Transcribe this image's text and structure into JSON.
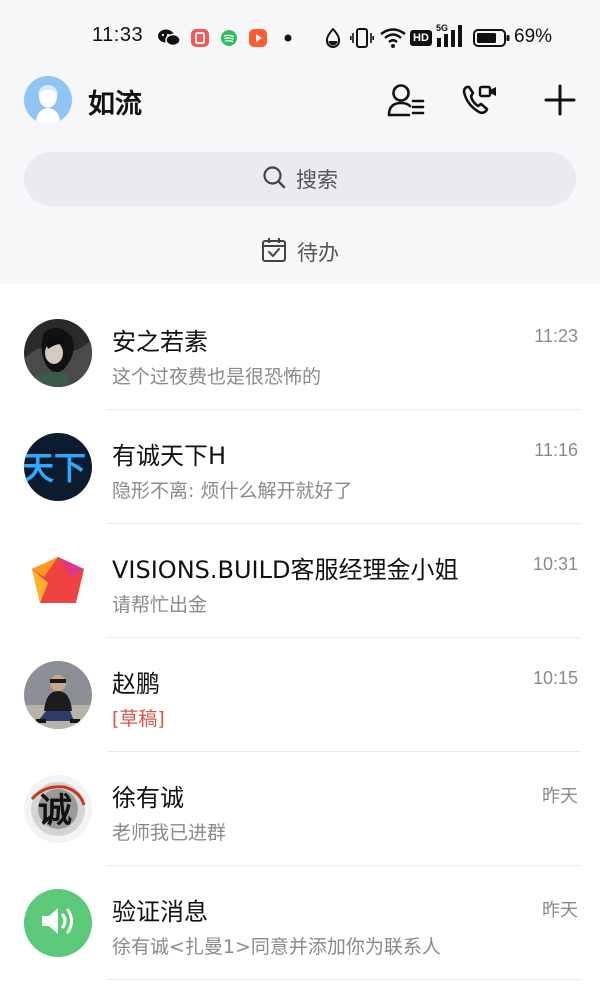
{
  "status_bar": {
    "time": "11:33",
    "network_label": "HD",
    "signal_label": "5G",
    "battery_percent": "69%",
    "icons": [
      "wechat-icon",
      "app-icon",
      "spotify-icon",
      "video-app-icon",
      "dot-icon",
      "water-drop-icon",
      "vibrate-icon",
      "wifi-icon",
      "hd-icon",
      "signal-5g-icon",
      "battery-icon"
    ]
  },
  "header": {
    "title": "如流"
  },
  "search": {
    "placeholder": "搜索"
  },
  "todo": {
    "label": "待办"
  },
  "conversations": [
    {
      "name": "安之若素",
      "preview": "这个过夜费也是很恐怖的",
      "time": "11:23"
    },
    {
      "name": "有诚天下H",
      "preview": "隐形不离: 烦什么解开就好了",
      "time": "11:16",
      "avatar_text": "天下"
    },
    {
      "name": "VISIONS.BUILD客服经理金小姐",
      "preview": "请帮忙出金",
      "time": "10:31"
    },
    {
      "name": "赵鹏",
      "preview": "[草稿]",
      "time": "10:15"
    },
    {
      "name": "徐有诚",
      "preview": "老师我已进群",
      "time": "昨天",
      "avatar_text": "诚"
    },
    {
      "name": "验证消息",
      "preview": "徐有诚<扎曼1>同意并添加你为联系人",
      "time": "昨天"
    }
  ],
  "colors": {
    "draft": "#d9534f",
    "verify_green": "#5cc97a",
    "accent_blue": "#8fc4f3"
  }
}
